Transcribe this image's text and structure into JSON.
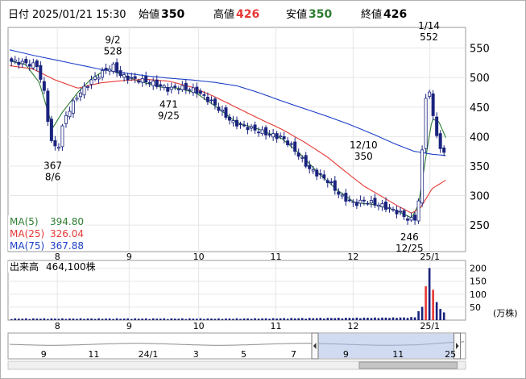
{
  "header": {
    "date_label": "日付",
    "datetime": "2025/01/21 15:30",
    "open_label": "始値",
    "open": "350",
    "high_label": "高値",
    "high": "426",
    "low_label": "安値",
    "low": "350",
    "close_label": "終値",
    "close": "426"
  },
  "colors": {
    "up": "#ffffff",
    "down": "#1a237e",
    "ma5": "#2e7d32",
    "ma25": "#e53935",
    "ma75": "#1e40c8",
    "high_value": "#e53935",
    "low_value": "#2e7d32",
    "volume_bar": "#1a237e",
    "volume_spike": "#e53935"
  },
  "legend": [
    {
      "name": "MA(5)",
      "value": "394.80",
      "color": "#2e7d32"
    },
    {
      "name": "MA(25)",
      "value": "326.04",
      "color": "#e53935"
    },
    {
      "name": "MA(75)",
      "value": "367.88",
      "color": "#1e40c8"
    }
  ],
  "volume_label": {
    "name": "出来高",
    "value": "464,100株"
  },
  "volume_unit": "(万株)",
  "chart_data": {
    "type": "candlestick",
    "x_ticks": [
      {
        "label": "8",
        "frac": 0.105
      },
      {
        "label": "9",
        "frac": 0.263
      },
      {
        "label": "10",
        "frac": 0.416
      },
      {
        "label": "11",
        "frac": 0.586
      },
      {
        "label": "12",
        "frac": 0.756
      },
      {
        "label": "25/1",
        "frac": 0.925
      }
    ],
    "price_axis": {
      "ticks": [
        "550",
        "500",
        "450",
        "400",
        "350",
        "300",
        "250"
      ],
      "ylim": [
        205,
        585
      ]
    },
    "volume_axis": {
      "ticks": [
        "200",
        "150",
        "100",
        "50"
      ],
      "ylim": [
        0,
        230
      ]
    },
    "annotations": [
      {
        "date": "1/14",
        "value": "552",
        "price": 552,
        "frac": 0.923,
        "pos": "above"
      },
      {
        "date": "9/2",
        "value": "528",
        "price": 528,
        "frac": 0.227,
        "pos": "above"
      },
      {
        "date": "12/10",
        "value": "350",
        "price": 350,
        "frac": 0.779,
        "pos": "above"
      },
      {
        "date": "471",
        "value": "9/25",
        "price": 471,
        "frac": 0.35,
        "pos": "below"
      },
      {
        "date": "367",
        "value": "8/6",
        "price": 367,
        "frac": 0.095,
        "pos": "below"
      },
      {
        "date": "246",
        "value": "12/25",
        "price": 246,
        "frac": 0.88,
        "pos": "below"
      }
    ],
    "path_anchors": [
      [
        0,
        528
      ],
      [
        0.03,
        525
      ],
      [
        0.06,
        520
      ],
      [
        0.075,
        480
      ],
      [
        0.09,
        395
      ],
      [
        0.105,
        375
      ],
      [
        0.12,
        430
      ],
      [
        0.15,
        470
      ],
      [
        0.18,
        495
      ],
      [
        0.21,
        512
      ],
      [
        0.227,
        520
      ],
      [
        0.245,
        503
      ],
      [
        0.27,
        498
      ],
      [
        0.31,
        492
      ],
      [
        0.35,
        480
      ],
      [
        0.37,
        484
      ],
      [
        0.41,
        478
      ],
      [
        0.45,
        455
      ],
      [
        0.49,
        424
      ],
      [
        0.53,
        414
      ],
      [
        0.57,
        404
      ],
      [
        0.6,
        398
      ],
      [
        0.62,
        384
      ],
      [
        0.66,
        345
      ],
      [
        0.7,
        325
      ],
      [
        0.73,
        298
      ],
      [
        0.76,
        286
      ],
      [
        0.78,
        291
      ],
      [
        0.82,
        283
      ],
      [
        0.86,
        270
      ],
      [
        0.88,
        258
      ],
      [
        0.895,
        262
      ],
      [
        0.905,
        320
      ],
      [
        0.913,
        465
      ],
      [
        0.923,
        478
      ],
      [
        0.935,
        420
      ],
      [
        0.945,
        390
      ],
      [
        0.953,
        352
      ],
      [
        0.96,
        405
      ]
    ],
    "ma_anchors": {
      "ma5": [
        [
          0,
          528
        ],
        [
          0.035,
          522
        ],
        [
          0.065,
          492
        ],
        [
          0.095,
          415
        ],
        [
          0.115,
          440
        ],
        [
          0.15,
          475
        ],
        [
          0.18,
          498
        ],
        [
          0.215,
          515
        ],
        [
          0.245,
          505
        ],
        [
          0.28,
          495
        ],
        [
          0.33,
          484
        ],
        [
          0.37,
          482
        ],
        [
          0.41,
          474
        ],
        [
          0.45,
          453
        ],
        [
          0.5,
          424
        ],
        [
          0.55,
          412
        ],
        [
          0.6,
          396
        ],
        [
          0.64,
          370
        ],
        [
          0.68,
          338
        ],
        [
          0.72,
          310
        ],
        [
          0.76,
          288
        ],
        [
          0.8,
          285
        ],
        [
          0.85,
          275
        ],
        [
          0.885,
          262
        ],
        [
          0.9,
          285
        ],
        [
          0.915,
          360
        ],
        [
          0.93,
          430
        ],
        [
          0.945,
          425
        ],
        [
          0.96,
          398
        ]
      ],
      "ma25": [
        [
          0,
          520
        ],
        [
          0.05,
          515
        ],
        [
          0.1,
          496
        ],
        [
          0.15,
          482
        ],
        [
          0.2,
          491
        ],
        [
          0.25,
          495
        ],
        [
          0.3,
          497
        ],
        [
          0.35,
          494
        ],
        [
          0.4,
          484
        ],
        [
          0.45,
          468
        ],
        [
          0.5,
          449
        ],
        [
          0.55,
          430
        ],
        [
          0.6,
          412
        ],
        [
          0.65,
          390
        ],
        [
          0.7,
          365
        ],
        [
          0.74,
          340
        ],
        [
          0.78,
          316
        ],
        [
          0.82,
          298
        ],
        [
          0.855,
          282
        ],
        [
          0.885,
          270
        ],
        [
          0.905,
          280
        ],
        [
          0.93,
          312
        ],
        [
          0.96,
          326
        ]
      ],
      "ma75": [
        [
          0,
          547
        ],
        [
          0.05,
          538
        ],
        [
          0.1,
          530
        ],
        [
          0.15,
          522
        ],
        [
          0.2,
          514
        ],
        [
          0.25,
          508
        ],
        [
          0.3,
          503
        ],
        [
          0.35,
          499
        ],
        [
          0.4,
          496
        ],
        [
          0.45,
          492
        ],
        [
          0.5,
          486
        ],
        [
          0.55,
          474
        ],
        [
          0.6,
          460
        ],
        [
          0.65,
          447
        ],
        [
          0.7,
          434
        ],
        [
          0.75,
          420
        ],
        [
          0.8,
          404
        ],
        [
          0.85,
          387
        ],
        [
          0.89,
          375
        ],
        [
          0.93,
          370
        ],
        [
          0.96,
          368
        ]
      ]
    },
    "volume_profile": [
      [
        0,
        4
      ],
      [
        0.5,
        4
      ],
      [
        0.875,
        8
      ],
      [
        0.895,
        10
      ],
      [
        0.905,
        55
      ],
      [
        0.912,
        40
      ],
      [
        0.918,
        175
      ],
      [
        0.923,
        210
      ],
      [
        0.928,
        150
      ],
      [
        0.935,
        90
      ],
      [
        0.945,
        45
      ],
      [
        0.955,
        30
      ],
      [
        0.965,
        25
      ]
    ],
    "navigator": {
      "x_ticks": [
        {
          "label": "9",
          "frac": 0.075
        },
        {
          "label": "11",
          "frac": 0.185
        },
        {
          "label": "24/1",
          "frac": 0.305
        },
        {
          "label": "3",
          "frac": 0.41
        },
        {
          "label": "5",
          "frac": 0.515
        },
        {
          "label": "7",
          "frac": 0.625
        },
        {
          "label": "9",
          "frac": 0.74
        },
        {
          "label": "11",
          "frac": 0.855
        },
        {
          "label": "25",
          "frac": 0.97
        }
      ],
      "window": [
        0.672,
        0.985
      ]
    }
  }
}
